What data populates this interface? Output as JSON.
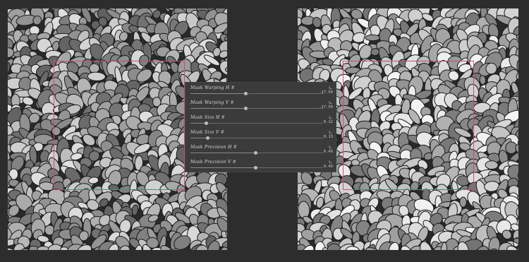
{
  "parameters": [
    {
      "label": "Mask Warping H",
      "value": "-17.50",
      "level": 0.42
    },
    {
      "label": "Mask Warping V",
      "value": "-17.50",
      "level": 0.42
    },
    {
      "label": "Mask Size H",
      "value": "0.12",
      "level": 0.12
    },
    {
      "label": "Mask Size V",
      "value": "0.13",
      "level": 0.13
    },
    {
      "label": "Mask Precision H",
      "value": "0.49",
      "level": 0.49
    },
    {
      "label": "Mask Precision V",
      "value": "0.49",
      "level": 0.49
    }
  ],
  "param_suffix": "#",
  "colors": {
    "selection_border": "#c8506a",
    "panel_bg": "#3b3b3b",
    "app_bg": "#2d2d2d"
  },
  "icons": {
    "reset": "reset-arrow-icon"
  }
}
